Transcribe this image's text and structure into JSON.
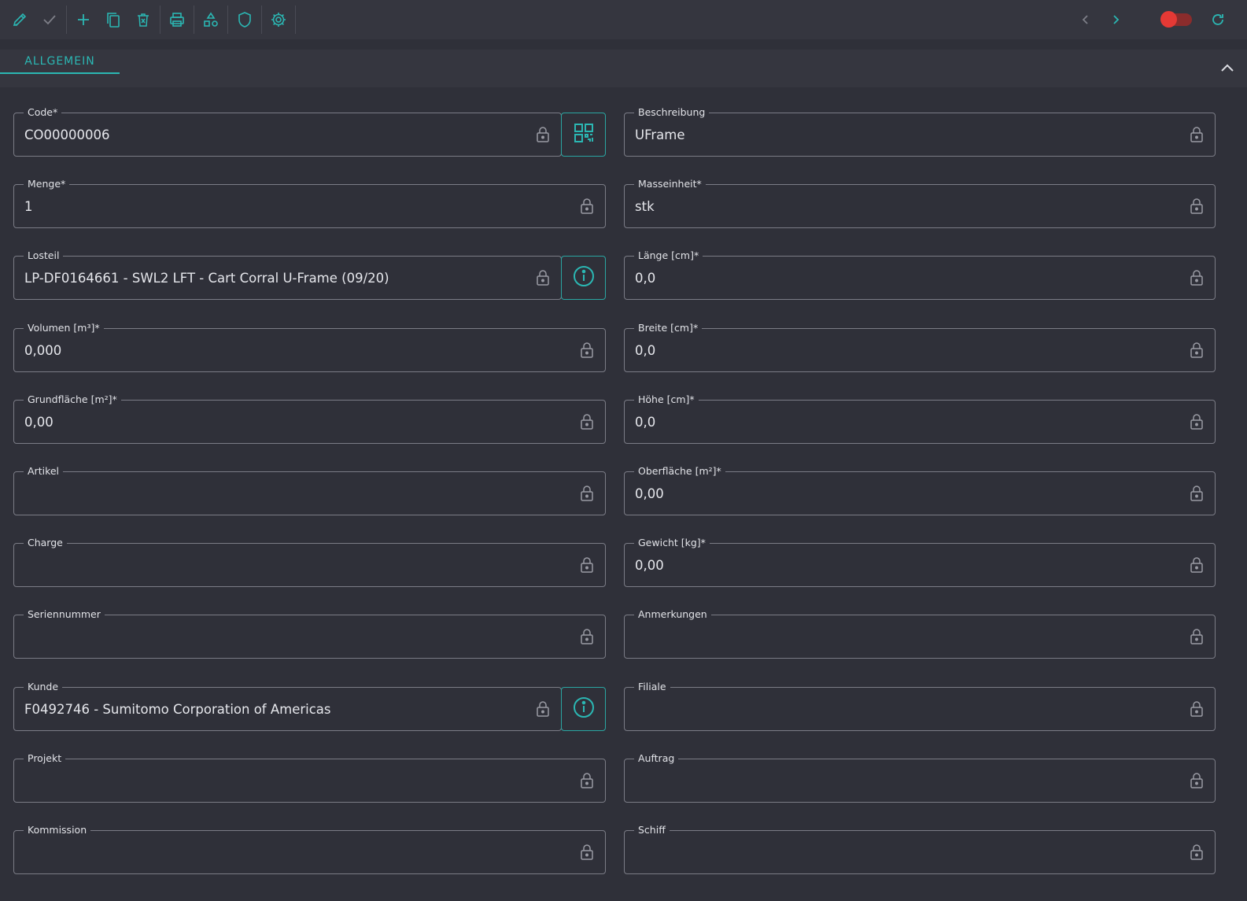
{
  "toolbar": {
    "icons": [
      "edit-icon",
      "check-icon",
      "add-icon",
      "copy-icon",
      "delete-icon",
      "print-icon",
      "shapes-icon",
      "shield-icon",
      "gear-icon"
    ],
    "nav": [
      "chevron-left-icon",
      "chevron-right-icon"
    ],
    "toggle_state": "off",
    "refresh_icon": "refresh-icon"
  },
  "tabs": [
    {
      "label": "ALLGEMEIN",
      "active": true
    }
  ],
  "colors": {
    "accent": "#2bb7b3",
    "toggle": "#e53935",
    "background": "#2f3039",
    "border": "#7b7c86"
  },
  "fields": {
    "code": {
      "label": "Code*",
      "value": "CO00000006"
    },
    "beschreibung": {
      "label": "Beschreibung",
      "value": "UFrame"
    },
    "menge": {
      "label": "Menge*",
      "value": "1"
    },
    "masseinheit": {
      "label": "Masseinheit*",
      "value": "stk"
    },
    "losteil": {
      "label": "Losteil",
      "value": "LP-DF0164661 - SWL2 LFT - Cart Corral U-Frame (09/20)"
    },
    "laenge": {
      "label": "Länge [cm]*",
      "value": "0,0"
    },
    "volumen": {
      "label": "Volumen [m³]*",
      "value": "0,000"
    },
    "breite": {
      "label": "Breite [cm]*",
      "value": "0,0"
    },
    "grundflaeche": {
      "label": "Grundfläche [m²]*",
      "value": "0,00"
    },
    "hoehe": {
      "label": "Höhe [cm]*",
      "value": "0,0"
    },
    "artikel": {
      "label": "Artikel",
      "value": ""
    },
    "oberflaeche": {
      "label": "Oberfläche [m²]*",
      "value": "0,00"
    },
    "charge": {
      "label": "Charge",
      "value": ""
    },
    "gewicht": {
      "label": "Gewicht [kg]*",
      "value": "0,00"
    },
    "seriennummer": {
      "label": "Seriennummer",
      "value": ""
    },
    "anmerkungen": {
      "label": "Anmerkungen",
      "value": ""
    },
    "kunde": {
      "label": "Kunde",
      "value": "F0492746 - Sumitomo Corporation of Americas"
    },
    "filiale": {
      "label": "Filiale",
      "value": ""
    },
    "projekt": {
      "label": "Projekt",
      "value": ""
    },
    "auftrag": {
      "label": "Auftrag",
      "value": ""
    },
    "kommission": {
      "label": "Kommission",
      "value": ""
    },
    "schiff": {
      "label": "Schiff",
      "value": ""
    }
  }
}
